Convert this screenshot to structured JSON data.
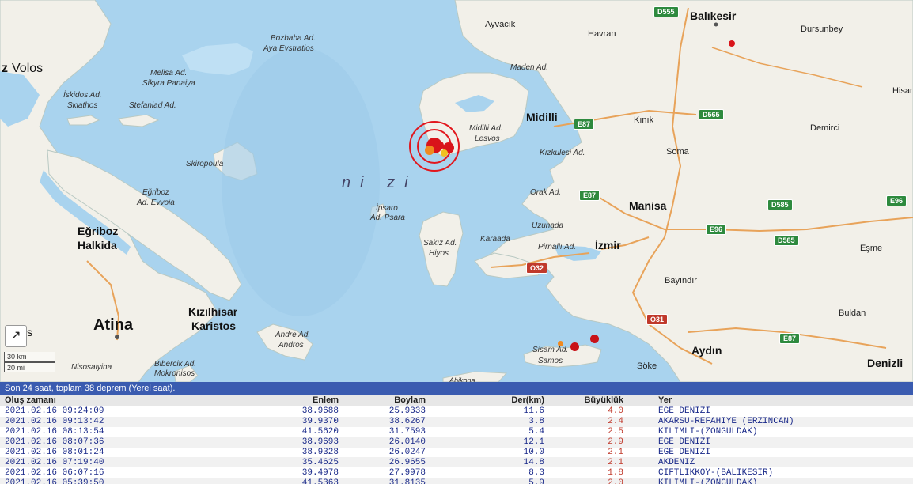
{
  "map": {
    "sea_label": "ni zi",
    "places": {
      "volos": "Volos",
      "volos_prefix": "z",
      "bozbaba": "Bozbaba Ad.",
      "aya": "Aya Evstratios",
      "melisa": "Melisa Ad.",
      "sikyra": "Sikyra Panaiya",
      "iskidos": "İskidos Ad.",
      "skiathos": "Skiathos",
      "stefaniad": "Stefaniad Ad.",
      "skiropoula": "Skiropoula",
      "egriboz_ad": "Eğriboz",
      "evvoia": "Ad. Evvoia",
      "egriboz": "Eğriboz",
      "halkida": "Halkida",
      "atina": "Atina",
      "atina_prefix": "s",
      "kizilhisar": "Kızılhisar",
      "karistos": "Karistos",
      "andre": "Andre Ad.",
      "andros": "Andros",
      "bibercik": "Bibercik Ad.",
      "mokronisos": "Mokronisos",
      "nisosalyina": "Nisosalyina",
      "ipsaro": "İpsaro",
      "psara": "Ad. Psara",
      "sakiz": "Sakız Ad.",
      "hiyos": "Hiyos",
      "karaada": "Karaada",
      "midilli_ad": "Midilli Ad.",
      "lesvos": "Lesvos",
      "midilli": "Midilli",
      "maden": "Maden Ad.",
      "ayvacik": "Ayvacık",
      "havran": "Havran",
      "balikesir": "Balıkesir",
      "dursunbey": "Dursunbey",
      "kinik": "Kınık",
      "kizkulesi": "Kızkulesi Ad.",
      "soma": "Soma",
      "demirci": "Demirci",
      "hisar": "Hisar",
      "orak": "Orak Ad.",
      "manisa": "Manisa",
      "uzunada": "Uzunada",
      "pirnalli": "Pirnallı Ad.",
      "izmir": "İzmir",
      "esme": "Eşme",
      "bayindir": "Bayındır",
      "buldan": "Buldan",
      "sisam": "Sisam Ad.",
      "samos": "Samos",
      "aydin": "Aydın",
      "soke": "Söke",
      "denizli": "Denizli",
      "abikona": "Abikona"
    },
    "roads": {
      "d555": "D555",
      "d565": "D565",
      "e87a": "E87",
      "e87b": "E87",
      "e87c": "E87",
      "e96a": "E96",
      "e96b": "E96",
      "d585a": "D585",
      "d585b": "D585",
      "o32": "O32",
      "o31": "O31"
    },
    "scale": {
      "km": "30 km",
      "mi": "20 mi"
    },
    "colors": {
      "sea": "#a9d3ee",
      "land": "#f2f0e9",
      "quake_red": "#d9141a",
      "quake_orange": "#f08a20",
      "highlight_ring": "#e2161c"
    }
  },
  "list": {
    "status": "Son 24 saat, toplam 38 deprem (Yerel saat).",
    "headers": [
      "Oluş zamanı",
      "Enlem",
      "Boylam",
      "Der(km)",
      "Büyüklük",
      "Yer"
    ],
    "rows": [
      [
        "2021.02.16 09:24:09",
        "38.9688",
        "25.9333",
        "11.6",
        "4.0",
        "EGE DENIZI"
      ],
      [
        "2021.02.16 09:13:42",
        "39.9370",
        "38.6267",
        "3.8",
        "2.4",
        "AKARSU-REFAHIYE (ERZINCAN)"
      ],
      [
        "2021.02.16 08:13:54",
        "41.5620",
        "31.7593",
        "5.4",
        "2.5",
        "KILIMLI-(ZONGULDAK)"
      ],
      [
        "2021.02.16 08:07:36",
        "38.9693",
        "26.0140",
        "12.1",
        "2.9",
        "EGE DENIZI"
      ],
      [
        "2021.02.16 08:01:24",
        "38.9328",
        "26.0247",
        "10.0",
        "2.1",
        "EGE DENIZI"
      ],
      [
        "2021.02.16 07:19:40",
        "35.4625",
        "26.9655",
        "14.8",
        "2.1",
        "AKDENIZ"
      ],
      [
        "2021.02.16 06:07:16",
        "39.4978",
        "27.9978",
        "8.3",
        "1.8",
        "CIFTLIKKOY-(BALIKESIR)"
      ],
      [
        "2021.02.16 05:39:50",
        "41.5363",
        "31.8135",
        "5.9",
        "2.0",
        "KILIMLI-(ZONGULDAK)"
      ]
    ]
  }
}
